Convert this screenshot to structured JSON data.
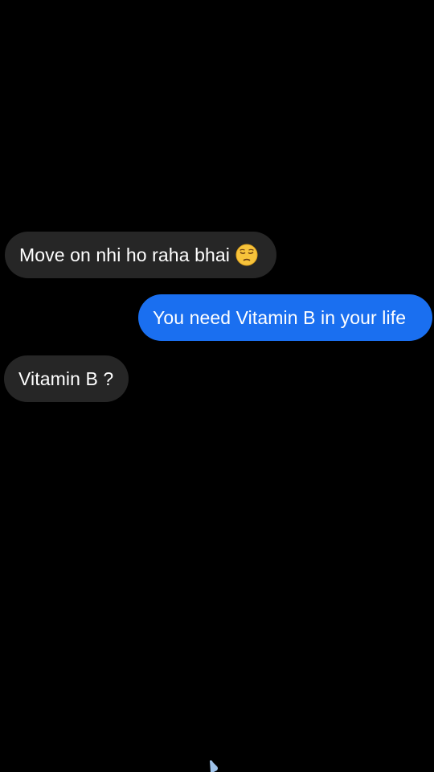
{
  "messages": [
    {
      "sender": "incoming",
      "text": "Move on nhi ho raha bhai",
      "emoji": "pensive-face-emoji"
    },
    {
      "sender": "outgoing",
      "text": "You need Vitamin B in your life"
    },
    {
      "sender": "incoming",
      "text": "Vitamin B ?"
    }
  ],
  "colors": {
    "background": "#000000",
    "incoming_bubble": "#262626",
    "outgoing_bubble": "#1a6ff0",
    "text": "#ffffff"
  }
}
